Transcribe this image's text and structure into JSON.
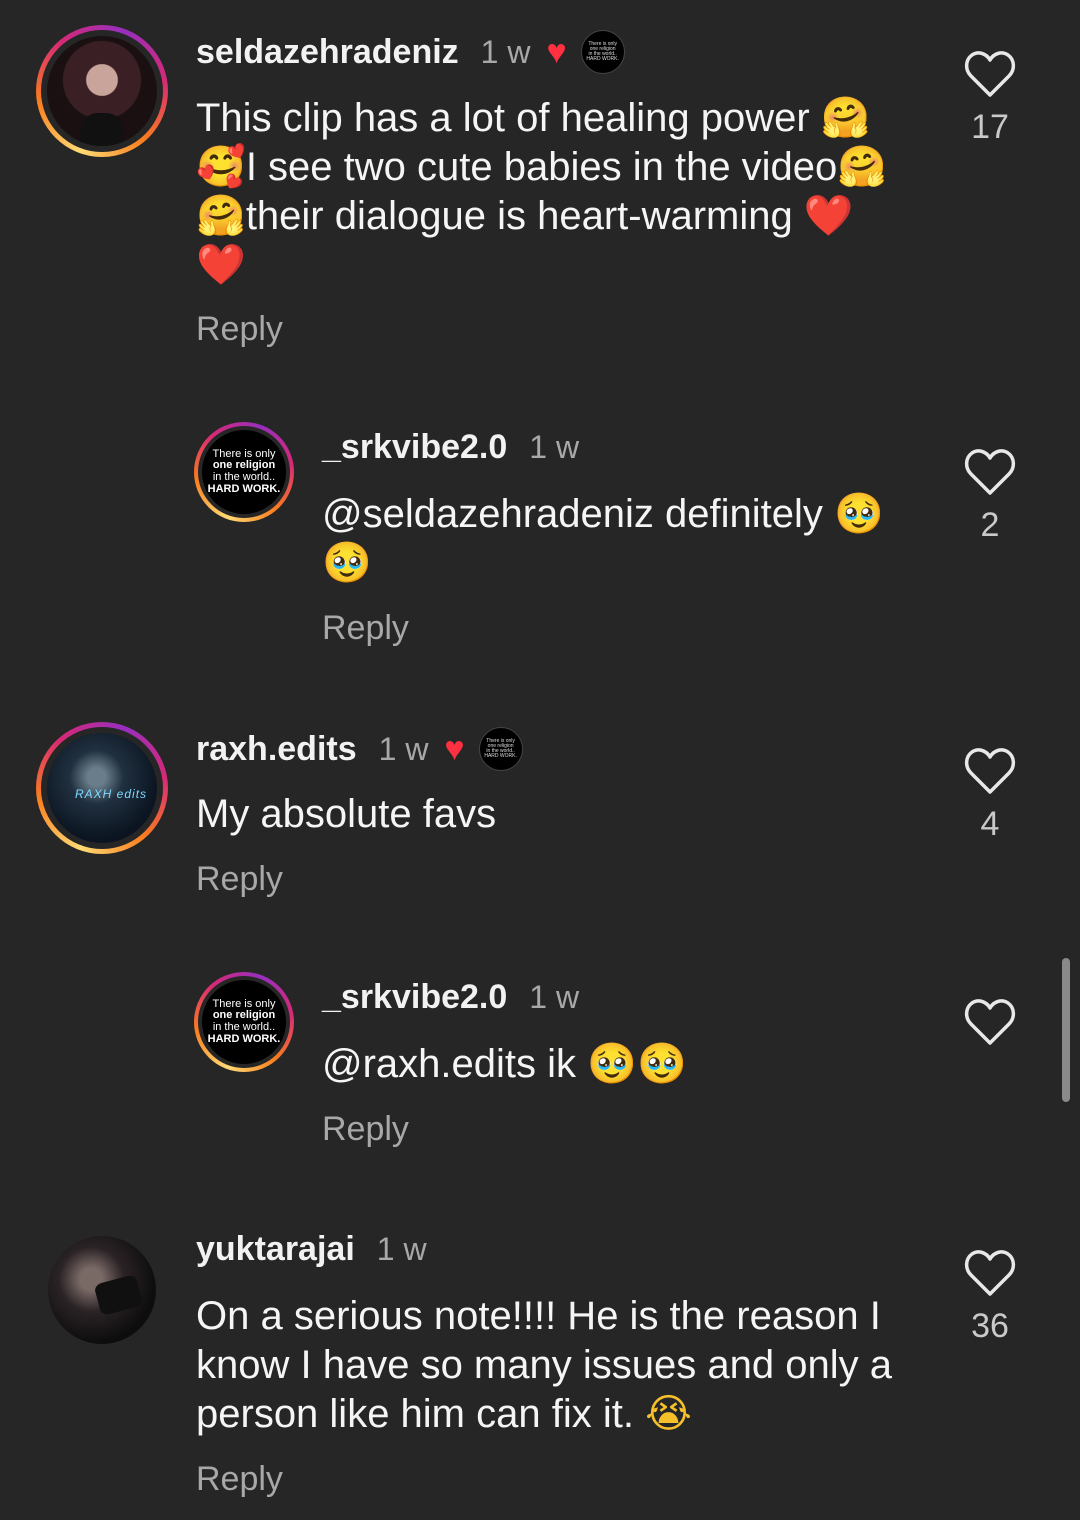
{
  "comments": [
    {
      "username": "seldazehradeniz",
      "time": "1 w",
      "body_parts": [
        "This clip has a lot of healing power ",
        "🤗",
        "🥰",
        "I see two cute babies in the video",
        "🤗",
        "🤗",
        "their dialogue is heart-warming ",
        "❤️",
        "❤️"
      ],
      "reply": "Reply",
      "likes": "17",
      "liked_by_creator": true
    },
    {
      "username": "_srkvibe2.0",
      "time": "1 w",
      "body_parts": [
        "@seldazehradeniz definitely ",
        "🥹",
        "🥹"
      ],
      "reply": "Reply",
      "likes": "2"
    },
    {
      "username": "raxh.edits",
      "time": "1 w",
      "body": "My absolute favs",
      "reply": "Reply",
      "likes": "4",
      "liked_by_creator": true
    },
    {
      "username": "_srkvibe2.0",
      "time": "1 w",
      "body_parts": [
        "@raxh.edits ik ",
        "🥹",
        "🥹"
      ],
      "reply": "Reply",
      "likes": ""
    },
    {
      "username": "yuktarajai",
      "time": "1 w",
      "body_lines": [
        "On a serious note!!!! He is the reason I",
        "know I have so many issues and only a",
        "person like him can fix it. "
      ],
      "body_emoji": "😭",
      "reply": "Reply",
      "likes": "36"
    }
  ],
  "badge_text": {
    "line1": "There is only",
    "line2": "one religion",
    "line3": "in the world..",
    "line4": "HARD WORK."
  },
  "raxh_avatar_tag": "RAXH edits",
  "colors": {
    "background": "#262626",
    "heart": "#ff3040",
    "secondary_text": "#a8a8a8"
  },
  "icons": {
    "like": "heart-outline-icon",
    "creator_like": "heart-filled-icon"
  }
}
